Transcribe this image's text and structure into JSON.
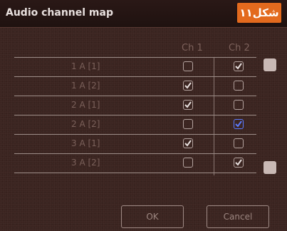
{
  "dialog": {
    "title": "Audio channel map",
    "badge": "شکل۱۱"
  },
  "columns": [
    "Ch 1",
    "Ch 2"
  ],
  "rows": [
    {
      "label": "1 A [1]",
      "ch1": false,
      "ch2": true
    },
    {
      "label": "1 A [2]",
      "ch1": true,
      "ch2": false
    },
    {
      "label": "2 A [1]",
      "ch1": true,
      "ch2": false
    },
    {
      "label": "2 A [2]",
      "ch1": false,
      "ch2": true
    },
    {
      "label": "3 A [1]",
      "ch1": true,
      "ch2": false
    },
    {
      "label": "3 A [2]",
      "ch1": false,
      "ch2": true
    }
  ],
  "buttons": {
    "ok": "OK",
    "cancel": "Cancel"
  },
  "colors": {
    "accent": "#e36a1e",
    "checked_blue": "#5b7bff"
  }
}
